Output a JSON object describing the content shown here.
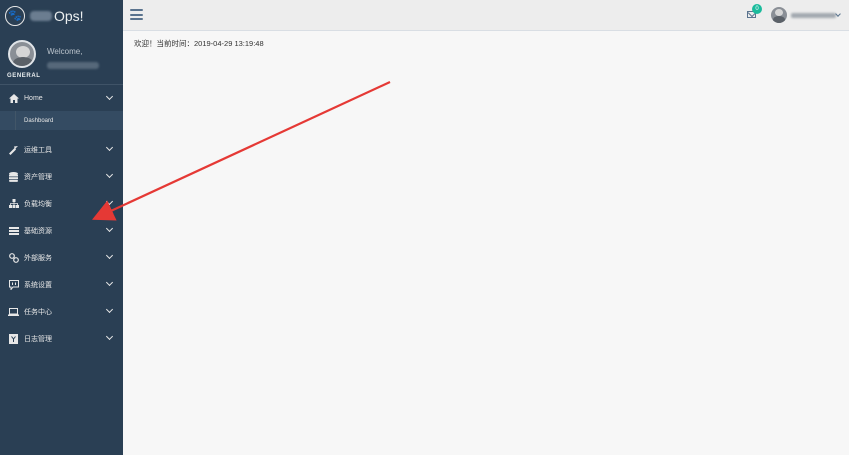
{
  "brand": {
    "name": "Ops!",
    "logo_icon": "paw-icon"
  },
  "profile": {
    "welcome": "Welcome,",
    "role": "GENERAL"
  },
  "sidebar": {
    "items": [
      {
        "label": "Home",
        "icon": "home-icon",
        "active": true,
        "submenu": [
          {
            "label": "Dashboard"
          }
        ]
      },
      {
        "label": "运维工具",
        "icon": "wrench-icon"
      },
      {
        "label": "资产管理",
        "icon": "database-icon"
      },
      {
        "label": "负载均衡",
        "icon": "sitemap-icon"
      },
      {
        "label": "基础资源",
        "icon": "server-icon"
      },
      {
        "label": "外部服务",
        "icon": "link-icon"
      },
      {
        "label": "系统设置",
        "icon": "settings-icon"
      },
      {
        "label": "任务中心",
        "icon": "laptop-icon"
      },
      {
        "label": "日志管理",
        "icon": "log-icon"
      }
    ]
  },
  "topbar": {
    "mail_badge": "0",
    "mail_icon": "envelope-icon",
    "menu_icon": "hamburger-icon"
  },
  "main": {
    "welcome_line": "欢迎！当前时间：2019-04-29 13:19:48"
  },
  "colors": {
    "sidebar_bg": "#2a3f54",
    "accent": "#1abb9c",
    "arrow": "#e53935"
  }
}
